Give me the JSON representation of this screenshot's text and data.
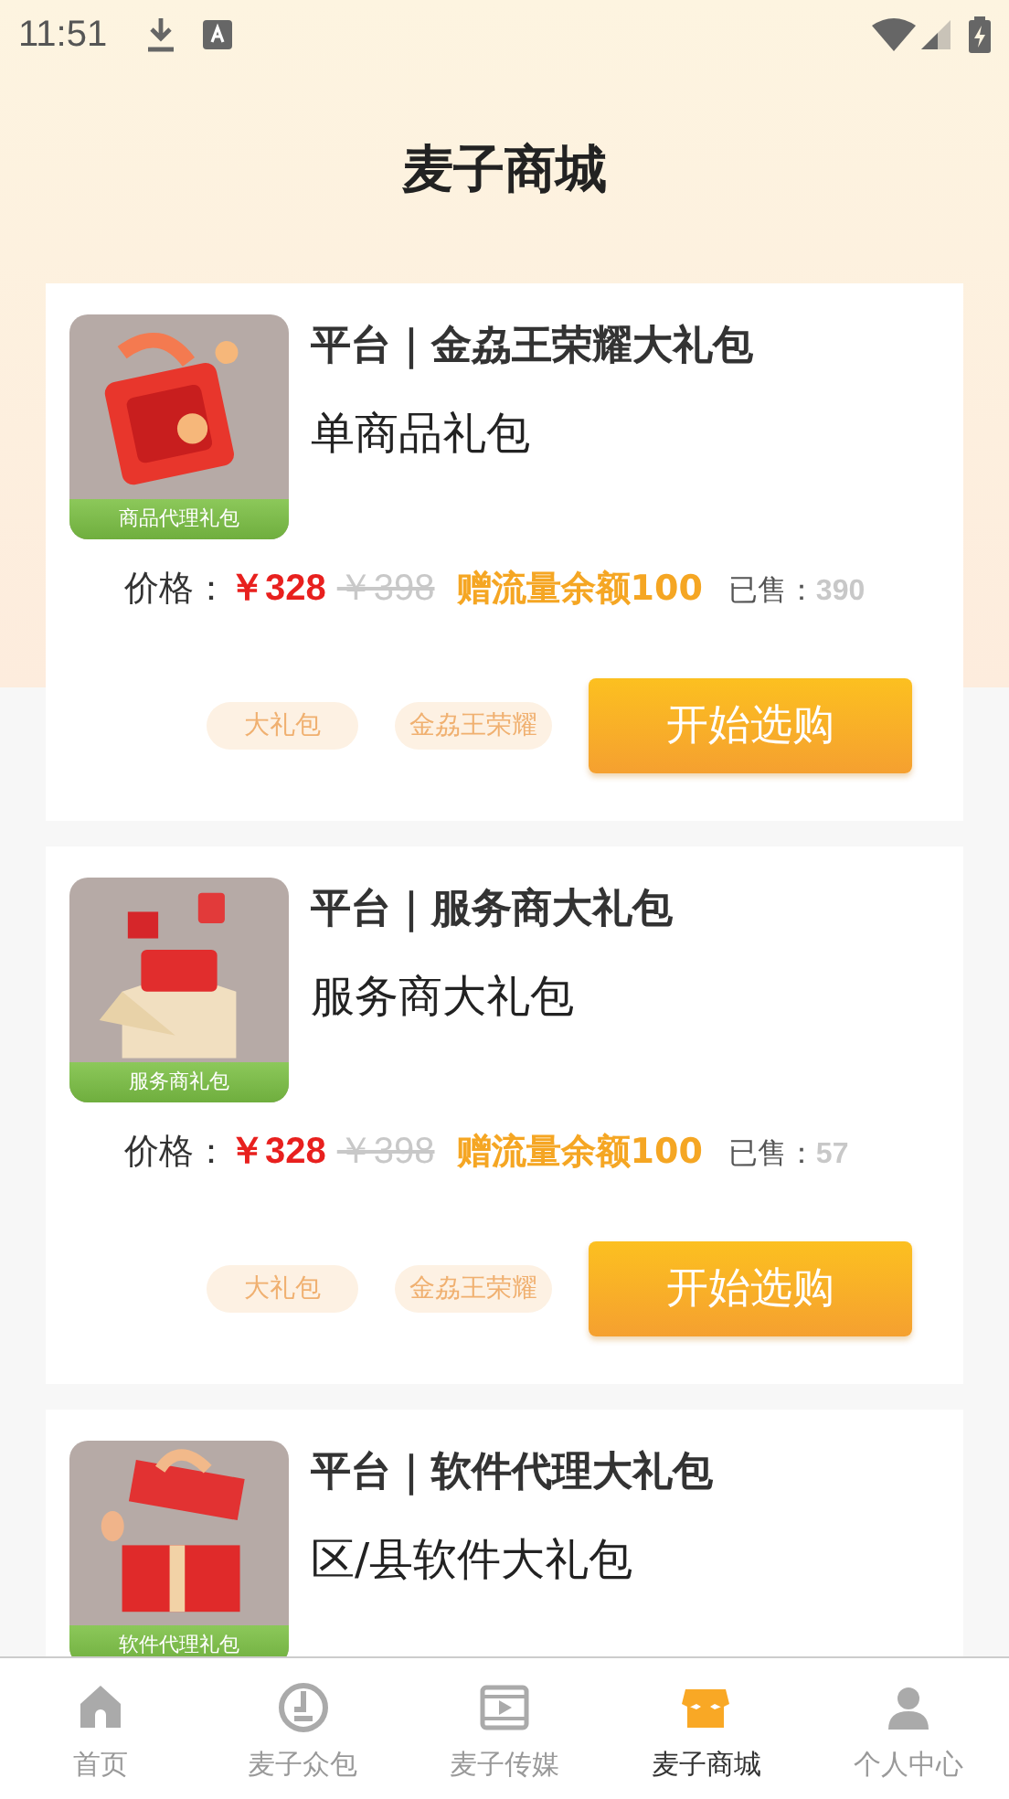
{
  "status_bar": {
    "time": "11:51"
  },
  "header": {
    "title": "麦子商城"
  },
  "products": [
    {
      "image_label": "商品代理礼包",
      "title": "平台｜金劦王荣耀大礼包",
      "subtitle": "单商品礼包",
      "price_label": "价格：",
      "price": "￥328",
      "original_price": "￥398",
      "bonus": "赠流量余额100",
      "sold_label": "已售：",
      "sold": "390",
      "tags": [
        "大礼包",
        "金劦王荣耀"
      ],
      "button": "开始选购"
    },
    {
      "image_label": "服务商礼包",
      "title": "平台｜服务商大礼包",
      "subtitle": "服务商大礼包",
      "price_label": "价格：",
      "price": "￥328",
      "original_price": "￥398",
      "bonus": "赠流量余额100",
      "sold_label": "已售：",
      "sold": "57",
      "tags": [
        "大礼包",
        "金劦王荣耀"
      ],
      "button": "开始选购"
    },
    {
      "image_label": "软件代理礼包",
      "title": "平台｜软件代理大礼包",
      "subtitle": "区/县软件大礼包"
    }
  ],
  "tab_bar": [
    {
      "kind": "home",
      "label": "首页",
      "selected": false
    },
    {
      "kind": "crowd",
      "label": "麦子众包",
      "selected": false
    },
    {
      "kind": "media",
      "label": "麦子传媒",
      "selected": false
    },
    {
      "kind": "shop",
      "label": "麦子商城",
      "selected": true
    },
    {
      "kind": "person",
      "label": "个人中心",
      "selected": false
    }
  ]
}
